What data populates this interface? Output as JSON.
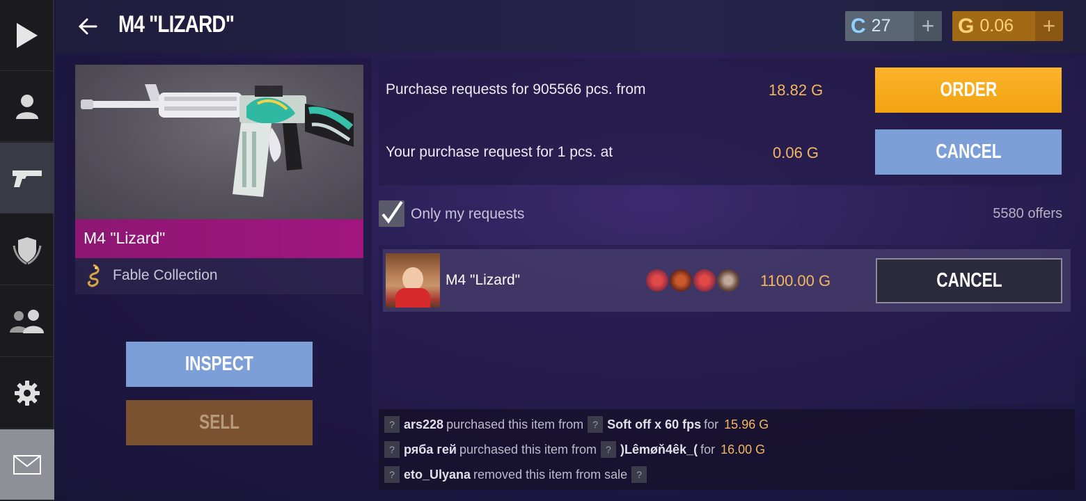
{
  "header": {
    "title": "M4 \"LIZARD\"",
    "credits": {
      "symbol": "C",
      "amount": "27",
      "plus": "+"
    },
    "gold": {
      "symbol": "G",
      "amount": "0.06",
      "plus": "+"
    }
  },
  "sidebar": {
    "items": [
      {
        "icon": "play-icon"
      },
      {
        "icon": "profile-icon"
      },
      {
        "icon": "pistol-icon"
      },
      {
        "icon": "clan-shield-icon"
      },
      {
        "icon": "friends-icon"
      },
      {
        "icon": "gear-icon"
      },
      {
        "icon": "mail-icon"
      }
    ]
  },
  "item": {
    "name": "M4 \"Lizard\"",
    "collection": "Fable Collection",
    "inspect_label": "INSPECT",
    "sell_label": "SELL"
  },
  "requests": {
    "line1_text": "Purchase requests for 905566 pcs. from",
    "line1_price": "18.82 G",
    "order_label": "ORDER",
    "line2_text": "Your purchase request for 1 pcs. at",
    "line2_price": "0.06 G",
    "cancel_label": "CANCEL"
  },
  "filter": {
    "label": "Only my requests",
    "checked": true,
    "offers": "5580 offers"
  },
  "listing": {
    "name": "M4 \"Lizard\"",
    "price": "1100.00 G",
    "cancel_label": "CANCEL"
  },
  "history": [
    {
      "q1": "?",
      "user": "ars228",
      "action": "purchased this item from",
      "q2": "?",
      "seller": "Soft off x 60 fps",
      "for": "for",
      "price": "15.96 G"
    },
    {
      "q1": "?",
      "user": "ряба гей",
      "action": "purchased this item from",
      "q2": "?",
      "seller": ")Lêmøň4êk_(",
      "for": "for",
      "price": "16.00 G"
    },
    {
      "q1": "?",
      "user": "eto_Ulyana",
      "action": "removed this item from sale",
      "q2": "?"
    }
  ],
  "colors": {
    "accent_order": "#F6A81A",
    "accent_blue": "#7D9FD8",
    "item_bar": "#9A1579",
    "gold_text": "#F3B760"
  }
}
